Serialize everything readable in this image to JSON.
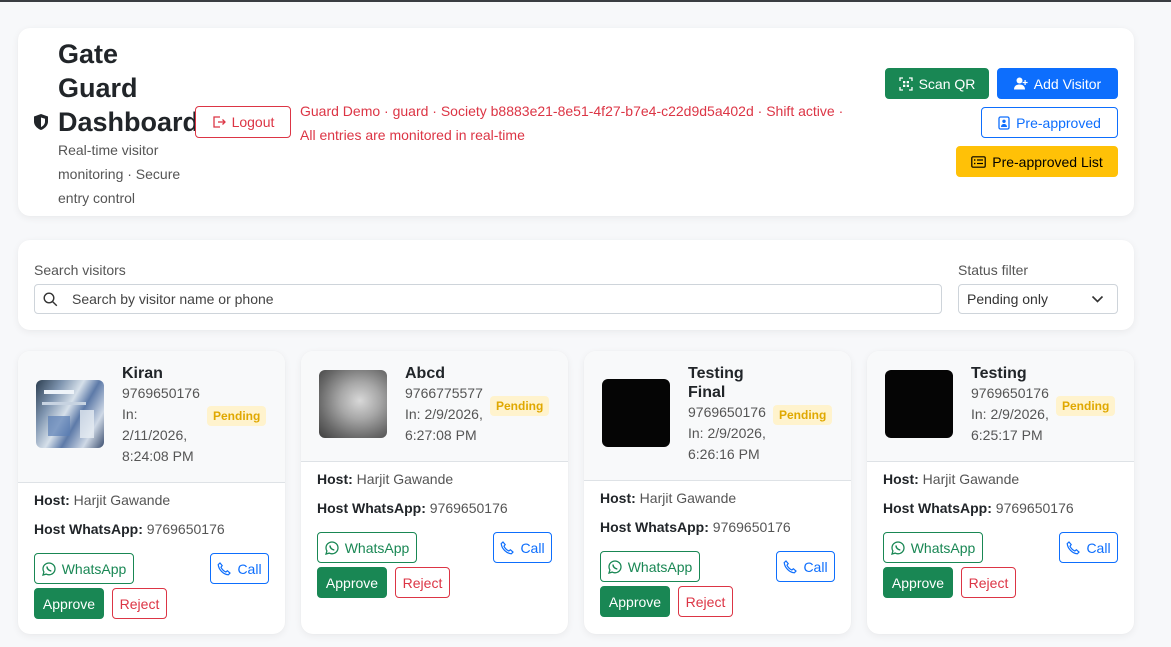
{
  "header": {
    "title_lines": [
      "Gate",
      "Guard",
      "Dashboard"
    ],
    "subtitle_lines": [
      "Real-time visitor",
      "monitoring · Secure",
      "entry control"
    ],
    "logout_label": "Logout",
    "info_line1": "Guard Demo · guard · Society b8883e21-8e51-4f27-b7e4-c22d9d5a402d · Shift active ·",
    "info_line2": "All entries are monitored in real-time",
    "scan_qr_label": "Scan QR",
    "add_visitor_label": "Add Visitor",
    "preapproved_label": "Pre-approved",
    "preapproved_list_label": "Pre-approved List"
  },
  "filters": {
    "search_label": "Search visitors",
    "search_placeholder": "Search by visitor name or phone",
    "status_label": "Status filter",
    "status_value": "Pending only"
  },
  "labels": {
    "host": "Host:",
    "host_whatsapp": "Host WhatsApp:",
    "whatsapp": "WhatsApp",
    "call": "Call",
    "approve": "Approve",
    "reject": "Reject",
    "pending": "Pending"
  },
  "colors": {
    "green": "#198754",
    "blue": "#0d6efd",
    "yellow": "#ffc107",
    "red": "#dc3545",
    "pending_bg": "#fff3cd",
    "pending_text": "#e0a800"
  },
  "visitors": [
    {
      "name": "Kiran",
      "phone": "9769650176",
      "in_lines": [
        "In:",
        "2/11/2026,",
        "8:24:08 PM"
      ],
      "host": "Harjit Gawande",
      "host_whatsapp": "9769650176"
    },
    {
      "name": "Abcd",
      "phone": "9766775577",
      "in_lines": [
        "In: 2/9/2026,",
        "6:27:08 PM"
      ],
      "host": "Harjit Gawande",
      "host_whatsapp": "9769650176"
    },
    {
      "name": "Testing Final",
      "name_lines": [
        "Testing",
        "Final"
      ],
      "phone": "9769650176",
      "in_lines": [
        "In: 2/9/2026,",
        "6:26:16 PM"
      ],
      "host": "Harjit Gawande",
      "host_whatsapp": "9769650176"
    },
    {
      "name": "Testing",
      "phone": "9769650176",
      "in_lines": [
        "In: 2/9/2026,",
        "6:25:17 PM"
      ],
      "host": "Harjit Gawande",
      "host_whatsapp": "9769650176"
    }
  ]
}
